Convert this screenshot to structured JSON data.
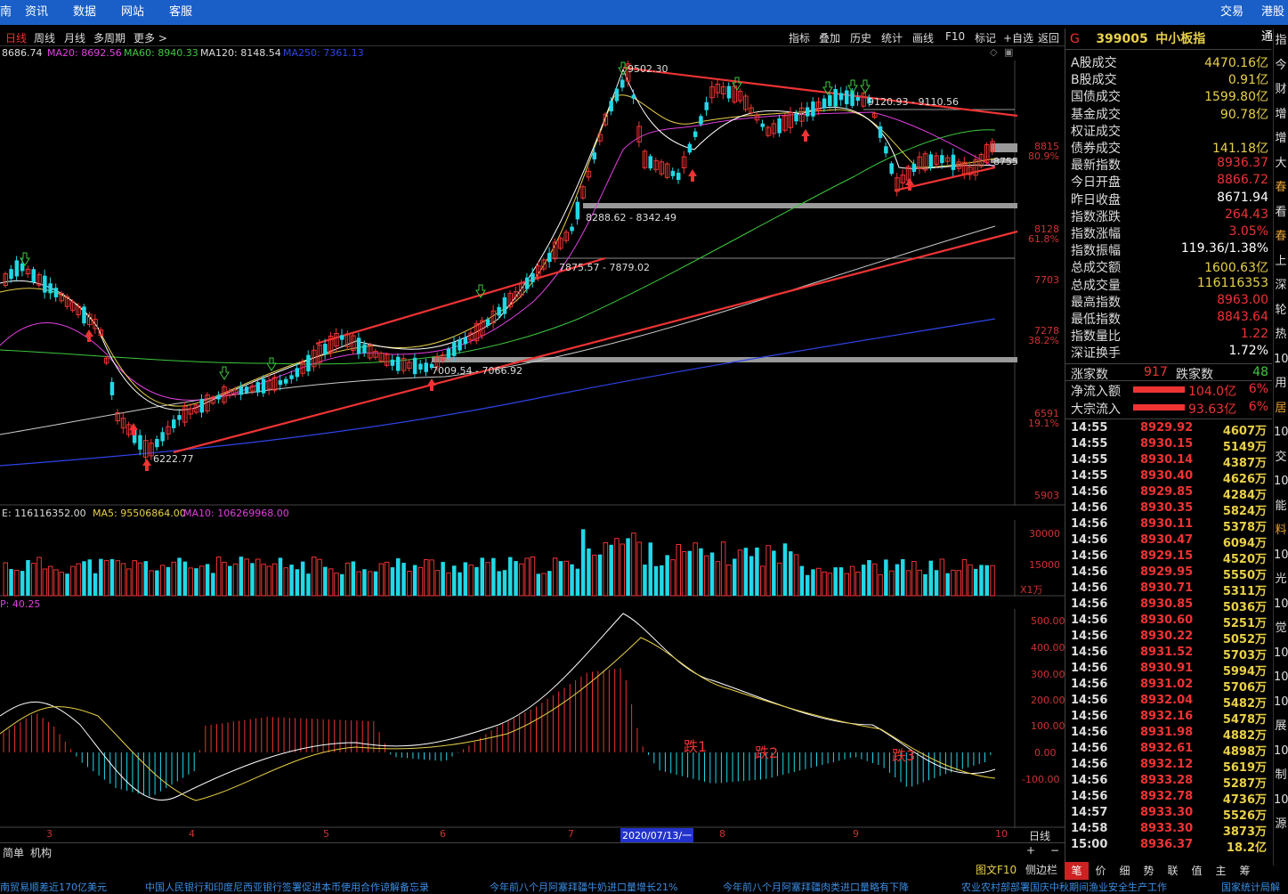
{
  "topbar": {
    "left_cut": "南",
    "nav": [
      "资讯",
      "数据",
      "网站",
      "客服"
    ],
    "right": [
      "交易",
      "港股通"
    ]
  },
  "toolbar": {
    "periods": [
      "日线",
      "周线",
      "月线",
      "多周期",
      "更多 >"
    ],
    "tools": [
      "指标",
      "叠加",
      "历史",
      "统计",
      "画线",
      "F10",
      "标记",
      "+自选",
      "返回"
    ]
  },
  "ma_row": {
    "ma10": "8686.74",
    "ma20": "MA20: 8692.56",
    "ma60": "MA60: 8940.33",
    "ma120": "MA120: 8148.54",
    "ma250": "MA250: 7361.13"
  },
  "price_axis": {
    "labels": [
      "8815",
      "80.9%",
      "8128",
      "61.8%",
      "7703",
      "7278",
      "38.2%",
      "6591",
      "19.1%",
      "5903"
    ]
  },
  "annotations": {
    "high": "9502.30",
    "range1": "9120.93 - 9110.56",
    "range2": "8288.62 - 8342.49",
    "range3": "7875.57 - 7879.02",
    "range4": "7009.54 - 7066.92",
    "low": "6222.77",
    "last": "8755"
  },
  "volume": {
    "label": "E: 116116352.00",
    "ma5": "MA5: 95506864.00",
    "ma10": "MA10: 106269968.00",
    "axis": [
      "30000",
      "15000"
    ],
    "unit": "X1万"
  },
  "macd": {
    "label": "P: 40.25",
    "axis": [
      "500.00",
      "400.00",
      "300.00",
      "200.00",
      "100.00",
      "0.00",
      "-100.00"
    ],
    "notes": [
      "跌1",
      "跌2",
      "跌3"
    ]
  },
  "date_axis": {
    "months": [
      "3",
      "4",
      "5",
      "6",
      "7",
      "8",
      "9",
      "10"
    ],
    "cursor": "2020/07/13/一",
    "period": "日线"
  },
  "bottom": {
    "items": [
      "简单",
      "机构"
    ]
  },
  "right_panel": {
    "code": "399005",
    "name": "中小板指",
    "flag": "G",
    "stats": [
      {
        "k": "A股成交",
        "v": "4470.16亿",
        "c": "#e8d04a"
      },
      {
        "k": "B股成交",
        "v": "0.91亿",
        "c": "#e8d04a"
      },
      {
        "k": "国债成交",
        "v": "1599.80亿",
        "c": "#e8d04a"
      },
      {
        "k": "基金成交",
        "v": "90.78亿",
        "c": "#e8d04a"
      },
      {
        "k": "权证成交",
        "v": "",
        "c": "#e8d04a"
      },
      {
        "k": "债券成交",
        "v": "141.18亿",
        "c": "#e8d04a"
      },
      {
        "k": "最新指数",
        "v": "8936.37",
        "c": "#e33"
      },
      {
        "k": "今日开盘",
        "v": "8866.72",
        "c": "#e33"
      },
      {
        "k": "昨日收盘",
        "v": "8671.94",
        "c": "#fff"
      },
      {
        "k": "指数涨跌",
        "v": "264.43",
        "c": "#e33"
      },
      {
        "k": "指数涨幅",
        "v": "3.05%",
        "c": "#e33"
      },
      {
        "k": "指数振幅",
        "v": "119.36/1.38%",
        "c": "#fff"
      },
      {
        "k": "总成交额",
        "v": "1600.63亿",
        "c": "#e8d04a"
      },
      {
        "k": "总成交量",
        "v": "116116353",
        "c": "#e8d04a"
      },
      {
        "k": "最高指数",
        "v": "8963.00",
        "c": "#e33"
      },
      {
        "k": "最低指数",
        "v": "8843.64",
        "c": "#e33"
      },
      {
        "k": "指数量比",
        "v": "1.22",
        "c": "#e33"
      },
      {
        "k": "深证换手",
        "v": "1.72%",
        "c": "#fff"
      }
    ],
    "rise_label": "涨家数",
    "rise": "917",
    "fall_label": "跌家数",
    "fall": "48",
    "flow": [
      {
        "k": "净流入额",
        "v": "104.0亿",
        "p": "6%"
      },
      {
        "k": "大宗流入",
        "v": "93.63亿",
        "p": "6%"
      }
    ],
    "ticks": [
      {
        "t": "14:55",
        "p": "8929.92",
        "q": "4607万"
      },
      {
        "t": "14:55",
        "p": "8930.15",
        "q": "5149万"
      },
      {
        "t": "14:55",
        "p": "8930.14",
        "q": "4387万"
      },
      {
        "t": "14:55",
        "p": "8930.40",
        "q": "4626万"
      },
      {
        "t": "14:56",
        "p": "8929.85",
        "q": "4284万"
      },
      {
        "t": "14:56",
        "p": "8930.35",
        "q": "5824万"
      },
      {
        "t": "14:56",
        "p": "8930.11",
        "q": "5378万"
      },
      {
        "t": "14:56",
        "p": "8930.47",
        "q": "6094万"
      },
      {
        "t": "14:56",
        "p": "8929.15",
        "q": "4520万"
      },
      {
        "t": "14:56",
        "p": "8929.95",
        "q": "5550万"
      },
      {
        "t": "14:56",
        "p": "8930.71",
        "q": "5311万"
      },
      {
        "t": "14:56",
        "p": "8930.85",
        "q": "5036万"
      },
      {
        "t": "14:56",
        "p": "8930.60",
        "q": "5251万"
      },
      {
        "t": "14:56",
        "p": "8930.22",
        "q": "5052万"
      },
      {
        "t": "14:56",
        "p": "8931.52",
        "q": "5703万"
      },
      {
        "t": "14:56",
        "p": "8930.91",
        "q": "5994万"
      },
      {
        "t": "14:56",
        "p": "8931.02",
        "q": "5706万"
      },
      {
        "t": "14:56",
        "p": "8932.04",
        "q": "5482万"
      },
      {
        "t": "14:56",
        "p": "8932.16",
        "q": "5478万"
      },
      {
        "t": "14:56",
        "p": "8931.98",
        "q": "4882万"
      },
      {
        "t": "14:56",
        "p": "8932.61",
        "q": "4898万"
      },
      {
        "t": "14:56",
        "p": "8932.12",
        "q": "5619万"
      },
      {
        "t": "14:56",
        "p": "8933.28",
        "q": "5287万"
      },
      {
        "t": "14:56",
        "p": "8932.78",
        "q": "4736万"
      },
      {
        "t": "14:57",
        "p": "8933.30",
        "q": "5526万"
      },
      {
        "t": "14:58",
        "p": "8933.30",
        "q": "3873万"
      },
      {
        "t": "15:00",
        "p": "8936.37",
        "q": "18.2亿"
      }
    ]
  },
  "far_right": [
    "指",
    "今",
    "财",
    "增",
    "增",
    "大",
    "春",
    "看",
    "春",
    "上",
    "深",
    "轮",
    "热",
    "10",
    "用",
    "居",
    "10",
    "交",
    "10",
    "能",
    "料",
    "10",
    "光",
    "10",
    "觉",
    "10",
    "10",
    "10",
    "展",
    "10",
    "制",
    "10",
    "源"
  ],
  "tabs": [
    "笔",
    "价",
    "细",
    "势",
    "联",
    "值",
    "主",
    "筹"
  ],
  "tab_bar_extra": [
    "图文F10",
    "侧边栏"
  ],
  "news": [
    "南贸易顺差近170亿美元",
    "中国人民银行和印度尼西亚银行签署促进本币使用合作谅解备忘录",
    "今年前八个月阿塞拜疆牛奶进口量增长21%",
    "今年前八个月阿塞拜疆肉类进口量略有下降",
    "农业农村部部署国庆中秋期间渔业安全生产工作",
    "国家统计局解"
  ]
}
